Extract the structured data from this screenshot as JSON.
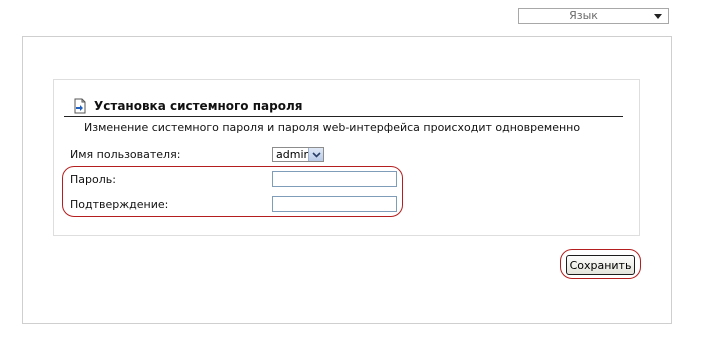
{
  "language_select": {
    "value": "Язык"
  },
  "section": {
    "title": "Установка системного пароля",
    "description": "Изменение системного пароля и пароля web-интерфейса происходит одновременно",
    "icon": "document-arrow-icon"
  },
  "form": {
    "username_label": "Имя пользователя:",
    "username_value": "admin",
    "password_label": "Пароль:",
    "password_value": "",
    "confirm_label": "Подтверждение:",
    "confirm_value": ""
  },
  "actions": {
    "save_label": "Сохранить"
  },
  "colors": {
    "highlight": "#b41e1e",
    "panel_border": "#cfcfcf",
    "input_border": "#7f9db9"
  }
}
